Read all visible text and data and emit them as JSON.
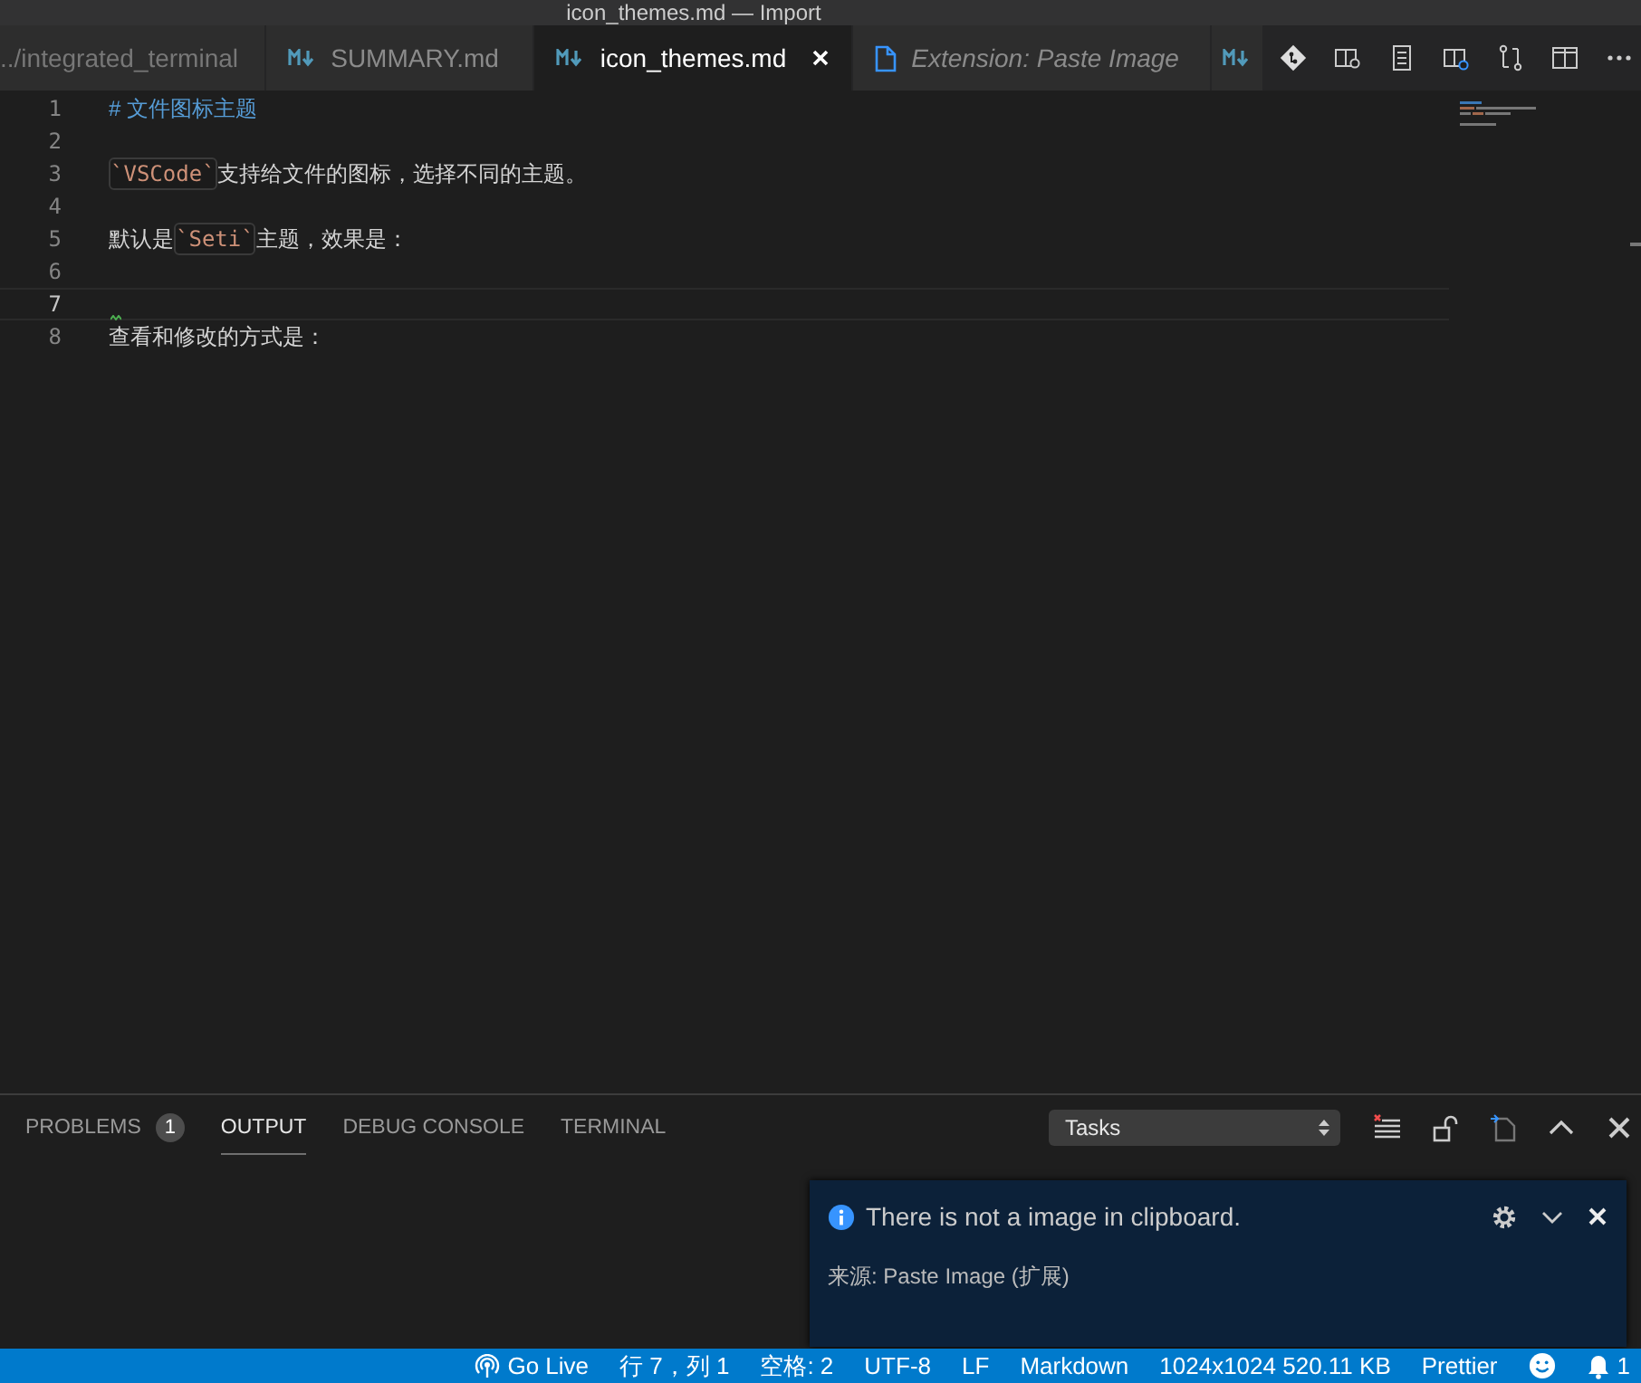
{
  "window": {
    "title": "icon_themes.md — Import"
  },
  "tabs": [
    {
      "label": "../integrated_terminal",
      "kind": "plain",
      "selected": false,
      "italic": false
    },
    {
      "label": "SUMMARY.md",
      "kind": "markdown",
      "selected": false,
      "italic": false
    },
    {
      "label": "icon_themes.md",
      "kind": "markdown",
      "selected": true,
      "italic": false
    },
    {
      "label": "Extension: Paste Image",
      "kind": "file",
      "selected": false,
      "italic": true
    },
    {
      "kind": "markdown",
      "selected": false
    }
  ],
  "editor": {
    "lines": [
      {
        "number": "1",
        "current": false,
        "squiggle": false,
        "segments": [
          {
            "kind": "heading",
            "text": "# 文件图标主题"
          }
        ]
      },
      {
        "number": "2",
        "current": false,
        "squiggle": false
      },
      {
        "number": "3",
        "current": false,
        "squiggle": false,
        "segments": [
          {
            "kind": "code",
            "text": "`VSCode`"
          },
          {
            "kind": "text",
            "text": "支持给文件的图标，选择不同的主题。"
          }
        ]
      },
      {
        "number": "4",
        "current": false,
        "squiggle": false
      },
      {
        "number": "5",
        "current": false,
        "squiggle": false,
        "segments": [
          {
            "kind": "text",
            "text": "默认是"
          },
          {
            "kind": "code",
            "text": "`Seti`"
          },
          {
            "kind": "text",
            "text": "主题，效果是："
          }
        ]
      },
      {
        "number": "6",
        "current": false,
        "squiggle": false
      },
      {
        "number": "7",
        "current": true,
        "squiggle": true
      },
      {
        "number": "8",
        "current": false,
        "squiggle": false,
        "segments": [
          {
            "kind": "text",
            "text": "查看和修改的方式是："
          }
        ]
      }
    ]
  },
  "panel": {
    "tabs": [
      {
        "label": "PROBLEMS",
        "badge": "1",
        "selected": false
      },
      {
        "label": "OUTPUT",
        "selected": true
      },
      {
        "label": "DEBUG CONSOLE",
        "selected": false
      },
      {
        "label": "TERMINAL",
        "selected": false
      }
    ],
    "select": {
      "value": "Tasks"
    }
  },
  "notification": {
    "message": "There is not a image in clipboard.",
    "source": "来源: Paste Image (扩展)"
  },
  "status_bar": {
    "items": [
      {
        "kind": "live",
        "text": "Go Live"
      },
      {
        "kind": "text",
        "text": "行 7，列 1"
      },
      {
        "kind": "text",
        "text": "空格: 2"
      },
      {
        "kind": "text",
        "text": "UTF-8"
      },
      {
        "kind": "text",
        "text": "LF"
      },
      {
        "kind": "text",
        "text": "Markdown"
      },
      {
        "kind": "text",
        "text": "1024x1024 520.11 KB"
      },
      {
        "kind": "text",
        "text": "Prettier"
      },
      {
        "kind": "smiley"
      },
      {
        "kind": "bell",
        "text": "1"
      }
    ]
  }
}
